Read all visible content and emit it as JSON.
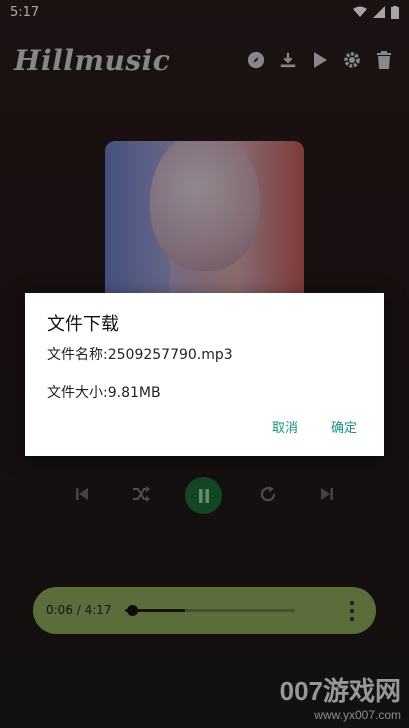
{
  "status_bar": {
    "time": "5:17"
  },
  "app": {
    "title": "Hillmusic"
  },
  "toolbar": {
    "icons": [
      "compass-icon",
      "download-icon",
      "play-icon",
      "gear-icon",
      "trash-icon"
    ]
  },
  "dialog": {
    "title": "文件下载",
    "file_name": "文件名称:2509257790.mp3",
    "file_size": "文件大小:9.81MB",
    "cancel_label": "取消",
    "ok_label": "确定"
  },
  "player": {
    "time": "0:06 / 4:17",
    "progress": 0.024,
    "buffered": 0.35
  },
  "watermark": {
    "brand": "007游戏网",
    "url": "www.yx007.com"
  },
  "colors": {
    "accent": "#1a8f7f",
    "player_bar": "#8da85a",
    "play_button": "#1d6e3a"
  }
}
